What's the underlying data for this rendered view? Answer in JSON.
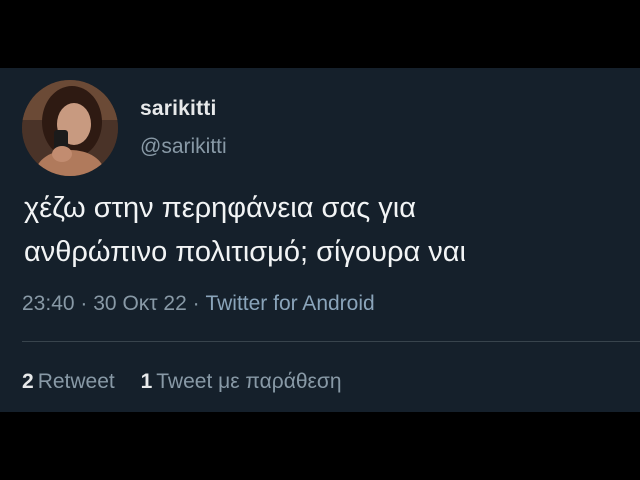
{
  "tweet": {
    "display_name": "sarikitti",
    "handle": "@sarikitti",
    "text_line1": "χέζω στην περηφάνεια σας για",
    "text_line2": "ανθρώπινο πολιτισμό; σίγουρα ναι",
    "time": "23:40",
    "separator": "·",
    "date": "30 Οκτ 22",
    "source": "Twitter for Android"
  },
  "stats": {
    "retweet_count": "2",
    "retweet_label": "Retweet",
    "quote_count": "1",
    "quote_label": "Tweet με παράθεση"
  },
  "colors": {
    "background": "#15202b",
    "text_primary": "#e7e9ea",
    "text_secondary": "#8899a6",
    "source_link": "#8aa4ba"
  }
}
